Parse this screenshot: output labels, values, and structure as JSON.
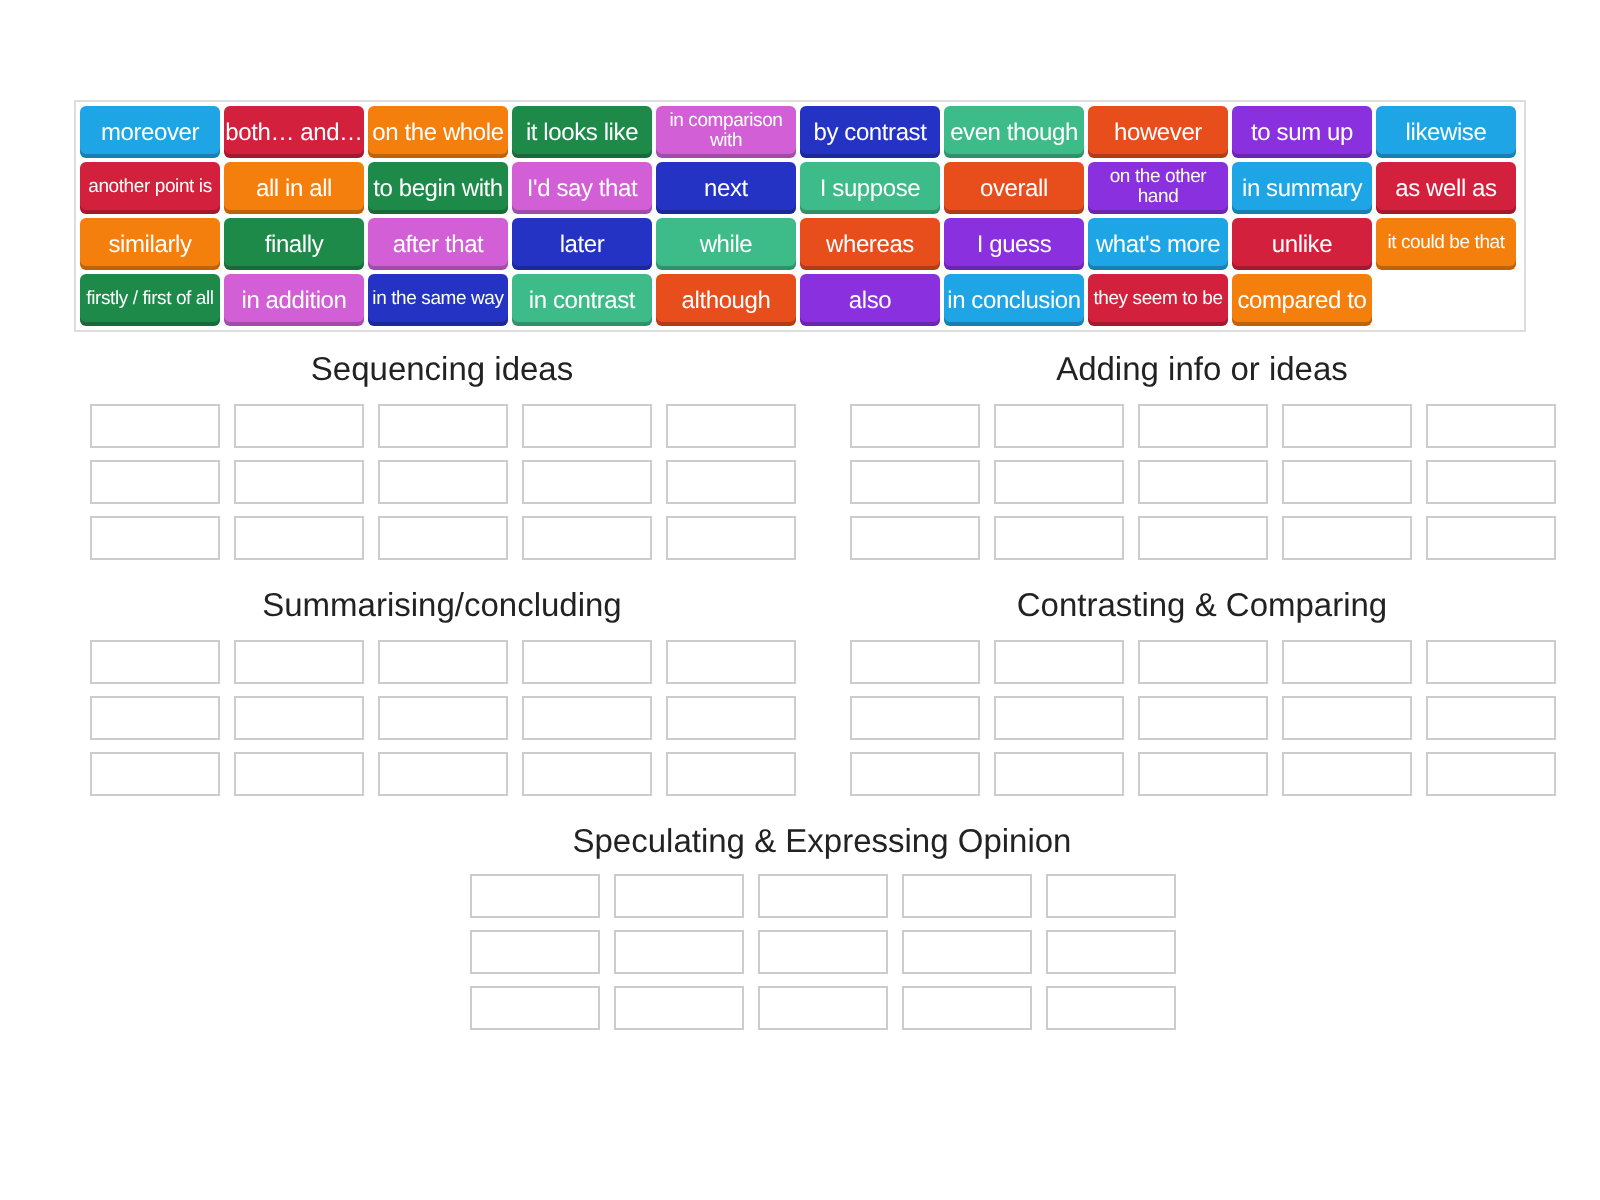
{
  "tiles": [
    {
      "text": "moreover",
      "kind": "word",
      "color": "#1ea5e6"
    },
    {
      "text": "both… and…",
      "kind": "word",
      "color": "#d3203c"
    },
    {
      "text": "on the whole",
      "kind": "word",
      "color": "#f57f0c"
    },
    {
      "text": "it looks like",
      "kind": "word",
      "color": "#1e8a4a"
    },
    {
      "text": "in comparison with",
      "kind": "phrase",
      "color": "#d35fd6"
    },
    {
      "text": "by contrast",
      "kind": "word",
      "color": "#2433c4"
    },
    {
      "text": "even though",
      "kind": "word",
      "color": "#3dbb88"
    },
    {
      "text": "however",
      "kind": "word",
      "color": "#e74e1c"
    },
    {
      "text": "to sum up",
      "kind": "word",
      "color": "#8a30df"
    },
    {
      "text": "likewise",
      "kind": "word",
      "color": "#1ea5e6"
    },
    {
      "text": "another point is",
      "kind": "phrase",
      "color": "#d3203c"
    },
    {
      "text": "all in all",
      "kind": "word",
      "color": "#f57f0c"
    },
    {
      "text": "to begin with",
      "kind": "word",
      "color": "#1e8a4a"
    },
    {
      "text": "I'd say that",
      "kind": "word",
      "color": "#d35fd6"
    },
    {
      "text": "next",
      "kind": "word",
      "color": "#2433c4"
    },
    {
      "text": "I suppose",
      "kind": "word",
      "color": "#3dbb88"
    },
    {
      "text": "overall",
      "kind": "word",
      "color": "#e74e1c"
    },
    {
      "text": "on the other hand",
      "kind": "phrase",
      "color": "#8a30df"
    },
    {
      "text": "in summary",
      "kind": "word",
      "color": "#1ea5e6"
    },
    {
      "text": "as well as",
      "kind": "word",
      "color": "#d3203c"
    },
    {
      "text": "similarly",
      "kind": "word",
      "color": "#f57f0c"
    },
    {
      "text": "finally",
      "kind": "word",
      "color": "#1e8a4a"
    },
    {
      "text": "after that",
      "kind": "word",
      "color": "#d35fd6"
    },
    {
      "text": "later",
      "kind": "word",
      "color": "#2433c4"
    },
    {
      "text": "while",
      "kind": "word",
      "color": "#3dbb88"
    },
    {
      "text": "whereas",
      "kind": "word",
      "color": "#e74e1c"
    },
    {
      "text": "I guess",
      "kind": "word",
      "color": "#8a30df"
    },
    {
      "text": "what's more",
      "kind": "word",
      "color": "#1ea5e6"
    },
    {
      "text": "unlike",
      "kind": "word",
      "color": "#d3203c"
    },
    {
      "text": "it could be that",
      "kind": "phrase",
      "color": "#f57f0c"
    },
    {
      "text": "firstly / first of all",
      "kind": "phrase",
      "color": "#1e8a4a"
    },
    {
      "text": "in addition",
      "kind": "word",
      "color": "#d35fd6"
    },
    {
      "text": "in the same way",
      "kind": "phrase",
      "color": "#2433c4"
    },
    {
      "text": "in contrast",
      "kind": "word",
      "color": "#3dbb88"
    },
    {
      "text": "although",
      "kind": "word",
      "color": "#e74e1c"
    },
    {
      "text": "also",
      "kind": "word",
      "color": "#8a30df"
    },
    {
      "text": "in conclusion",
      "kind": "word",
      "color": "#1ea5e6"
    },
    {
      "text": "they seem to be",
      "kind": "phrase",
      "color": "#d3203c"
    },
    {
      "text": "compared to",
      "kind": "word",
      "color": "#f57f0c"
    }
  ],
  "groups": [
    {
      "title": "Sequencing ideas"
    },
    {
      "title": "Adding info or ideas"
    },
    {
      "title": "Summarising/concluding"
    },
    {
      "title": "Contrasting & Comparing"
    },
    {
      "title": "Speculating & Expressing Opinion"
    }
  ]
}
